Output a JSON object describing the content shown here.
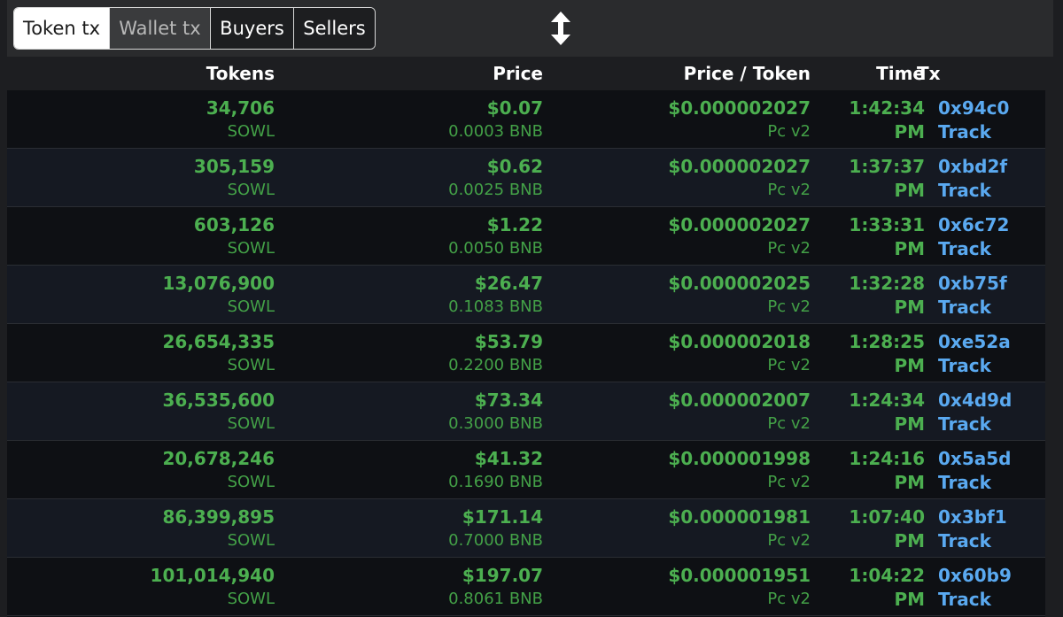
{
  "tabs": [
    {
      "label": "Token tx",
      "state": "active"
    },
    {
      "label": "Wallet tx",
      "state": "muted"
    },
    {
      "label": "Buyers",
      "state": "normal"
    },
    {
      "label": "Sellers",
      "state": "normal"
    }
  ],
  "resize_icon": "vertical-resize-icon",
  "columns": {
    "tokens": "Tokens",
    "price": "Price",
    "price_per_token": "Price / Token",
    "time": "Time",
    "tx": "Tx"
  },
  "colors": {
    "positive_green": "#4caf50",
    "link_blue": "#5aa9f0"
  },
  "rows": [
    {
      "tokens": "34,706",
      "symbol": "SOWL",
      "price_usd": "$0.07",
      "price_bnb": "0.0003 BNB",
      "ppt": "$0.000002027",
      "dex": "Pc v2",
      "time": "1:42:34",
      "ampm": "PM",
      "tx": "0x94c0",
      "track": "Track"
    },
    {
      "tokens": "305,159",
      "symbol": "SOWL",
      "price_usd": "$0.62",
      "price_bnb": "0.0025 BNB",
      "ppt": "$0.000002027",
      "dex": "Pc v2",
      "time": "1:37:37",
      "ampm": "PM",
      "tx": "0xbd2f",
      "track": "Track"
    },
    {
      "tokens": "603,126",
      "symbol": "SOWL",
      "price_usd": "$1.22",
      "price_bnb": "0.0050 BNB",
      "ppt": "$0.000002027",
      "dex": "Pc v2",
      "time": "1:33:31",
      "ampm": "PM",
      "tx": "0x6c72",
      "track": "Track"
    },
    {
      "tokens": "13,076,900",
      "symbol": "SOWL",
      "price_usd": "$26.47",
      "price_bnb": "0.1083 BNB",
      "ppt": "$0.000002025",
      "dex": "Pc v2",
      "time": "1:32:28",
      "ampm": "PM",
      "tx": "0xb75f",
      "track": "Track"
    },
    {
      "tokens": "26,654,335",
      "symbol": "SOWL",
      "price_usd": "$53.79",
      "price_bnb": "0.2200 BNB",
      "ppt": "$0.000002018",
      "dex": "Pc v2",
      "time": "1:28:25",
      "ampm": "PM",
      "tx": "0xe52a",
      "track": "Track"
    },
    {
      "tokens": "36,535,600",
      "symbol": "SOWL",
      "price_usd": "$73.34",
      "price_bnb": "0.3000 BNB",
      "ppt": "$0.000002007",
      "dex": "Pc v2",
      "time": "1:24:34",
      "ampm": "PM",
      "tx": "0x4d9d",
      "track": "Track"
    },
    {
      "tokens": "20,678,246",
      "symbol": "SOWL",
      "price_usd": "$41.32",
      "price_bnb": "0.1690 BNB",
      "ppt": "$0.000001998",
      "dex": "Pc v2",
      "time": "1:24:16",
      "ampm": "PM",
      "tx": "0x5a5d",
      "track": "Track"
    },
    {
      "tokens": "86,399,895",
      "symbol": "SOWL",
      "price_usd": "$171.14",
      "price_bnb": "0.7000 BNB",
      "ppt": "$0.000001981",
      "dex": "Pc v2",
      "time": "1:07:40",
      "ampm": "PM",
      "tx": "0x3bf1",
      "track": "Track"
    },
    {
      "tokens": "101,014,940",
      "symbol": "SOWL",
      "price_usd": "$197.07",
      "price_bnb": "0.8061 BNB",
      "ppt": "$0.000001951",
      "dex": "Pc v2",
      "time": "1:04:22",
      "ampm": "PM",
      "tx": "0x60b9",
      "track": "Track"
    }
  ]
}
